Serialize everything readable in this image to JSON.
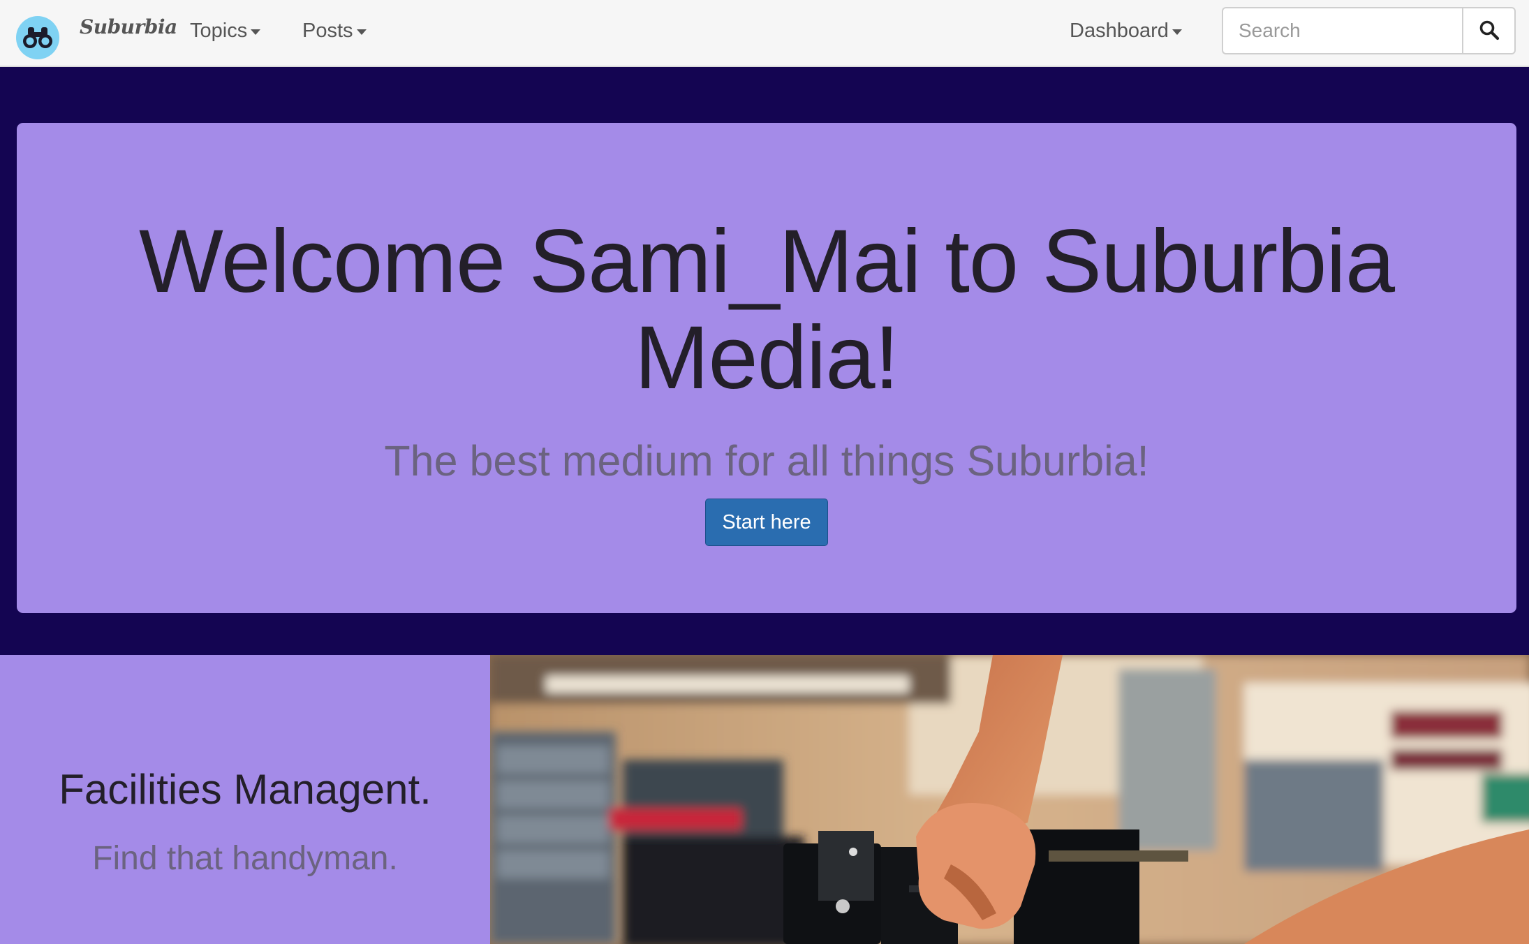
{
  "navbar": {
    "brand": "Suburbia",
    "logo_icon": "binoculars-icon",
    "items": [
      {
        "label": "Topics",
        "icon": "caret-down-icon"
      },
      {
        "label": "Posts",
        "icon": "caret-down-icon"
      },
      {
        "label": "Dashboard",
        "icon": "caret-down-icon"
      }
    ],
    "search": {
      "placeholder": "Search",
      "value": "",
      "button_icon": "magnifier-icon"
    }
  },
  "hero": {
    "title": "Welcome Sami_Mai to Suburbia Media!",
    "subtitle": "The best medium for all things Suburbia!",
    "button_label": "Start here"
  },
  "feature": {
    "heading": "Facilities Managent.",
    "subheading": "Find that handyman.",
    "image_icon": "workshop-photo"
  },
  "colors": {
    "page_background": "#140552",
    "accent_purple": "#a48be8",
    "primary_button": "#2a6db0",
    "logo_circle": "#7fd2f3",
    "navbar": "#f6f6f6"
  }
}
